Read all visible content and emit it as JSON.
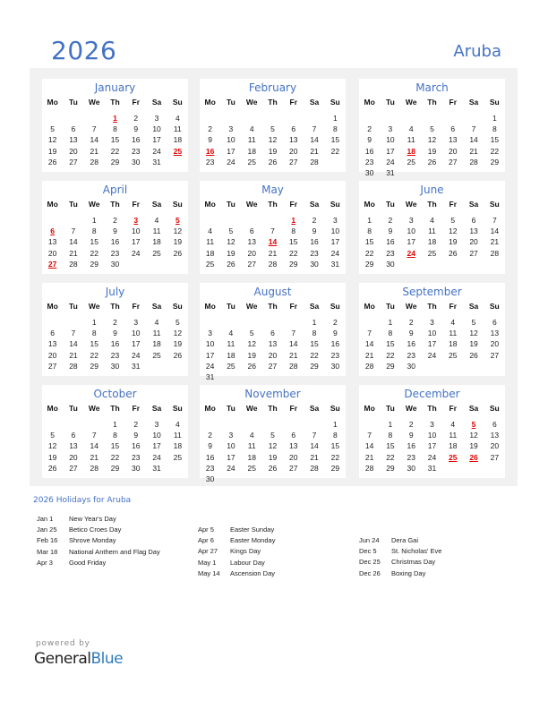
{
  "header": {
    "year": "2026",
    "country": "Aruba"
  },
  "weekdays": [
    "Mo",
    "Tu",
    "We",
    "Th",
    "Fr",
    "Sa",
    "Su"
  ],
  "colors": {
    "accent": "#4472c4",
    "holiday": "#e00000",
    "panel_bg": "#f1f1f1",
    "brand_blue": "#2e7bbd"
  },
  "months": [
    {
      "name": "January",
      "offset": 3,
      "days": 31,
      "holidays": [
        1,
        25
      ]
    },
    {
      "name": "February",
      "offset": 6,
      "days": 28,
      "holidays": [
        16
      ]
    },
    {
      "name": "March",
      "offset": 6,
      "days": 31,
      "holidays": [
        18
      ]
    },
    {
      "name": "April",
      "offset": 2,
      "days": 30,
      "holidays": [
        3,
        5,
        6,
        27
      ]
    },
    {
      "name": "May",
      "offset": 4,
      "days": 31,
      "holidays": [
        1,
        14
      ]
    },
    {
      "name": "June",
      "offset": 0,
      "days": 30,
      "holidays": [
        24
      ]
    },
    {
      "name": "July",
      "offset": 2,
      "days": 31,
      "holidays": []
    },
    {
      "name": "August",
      "offset": 5,
      "days": 31,
      "holidays": []
    },
    {
      "name": "September",
      "offset": 1,
      "days": 30,
      "holidays": []
    },
    {
      "name": "October",
      "offset": 3,
      "days": 31,
      "holidays": []
    },
    {
      "name": "November",
      "offset": 6,
      "days": 30,
      "holidays": []
    },
    {
      "name": "December",
      "offset": 1,
      "days": 31,
      "holidays": [
        5,
        25,
        26
      ]
    }
  ],
  "holidays_section": {
    "title": "2026 Holidays for Aruba",
    "columns": [
      [
        {
          "date": "Jan 1",
          "name": "New Year's Day"
        },
        {
          "date": "Jan 25",
          "name": "Betico Croes Day"
        },
        {
          "date": "Feb 16",
          "name": "Shrove Monday"
        },
        {
          "date": "Mar 18",
          "name": "National Anthem and Flag Day"
        },
        {
          "date": "Apr 3",
          "name": "Good Friday"
        }
      ],
      [
        {
          "date": "Apr 5",
          "name": "Easter Sunday"
        },
        {
          "date": "Apr 6",
          "name": "Easter Monday"
        },
        {
          "date": "Apr 27",
          "name": "Kings Day"
        },
        {
          "date": "May 1",
          "name": "Labour Day"
        },
        {
          "date": "May 14",
          "name": "Ascension Day"
        }
      ],
      [
        {
          "date": "Jun 24",
          "name": "Dera Gai"
        },
        {
          "date": "Dec 5",
          "name": "St. Nicholas' Eve"
        },
        {
          "date": "Dec 25",
          "name": "Christmas Day"
        },
        {
          "date": "Dec 26",
          "name": "Boxing Day"
        }
      ]
    ]
  },
  "footer": {
    "powered_by": "powered by",
    "brand_general": "General",
    "brand_blue": "Blue"
  }
}
